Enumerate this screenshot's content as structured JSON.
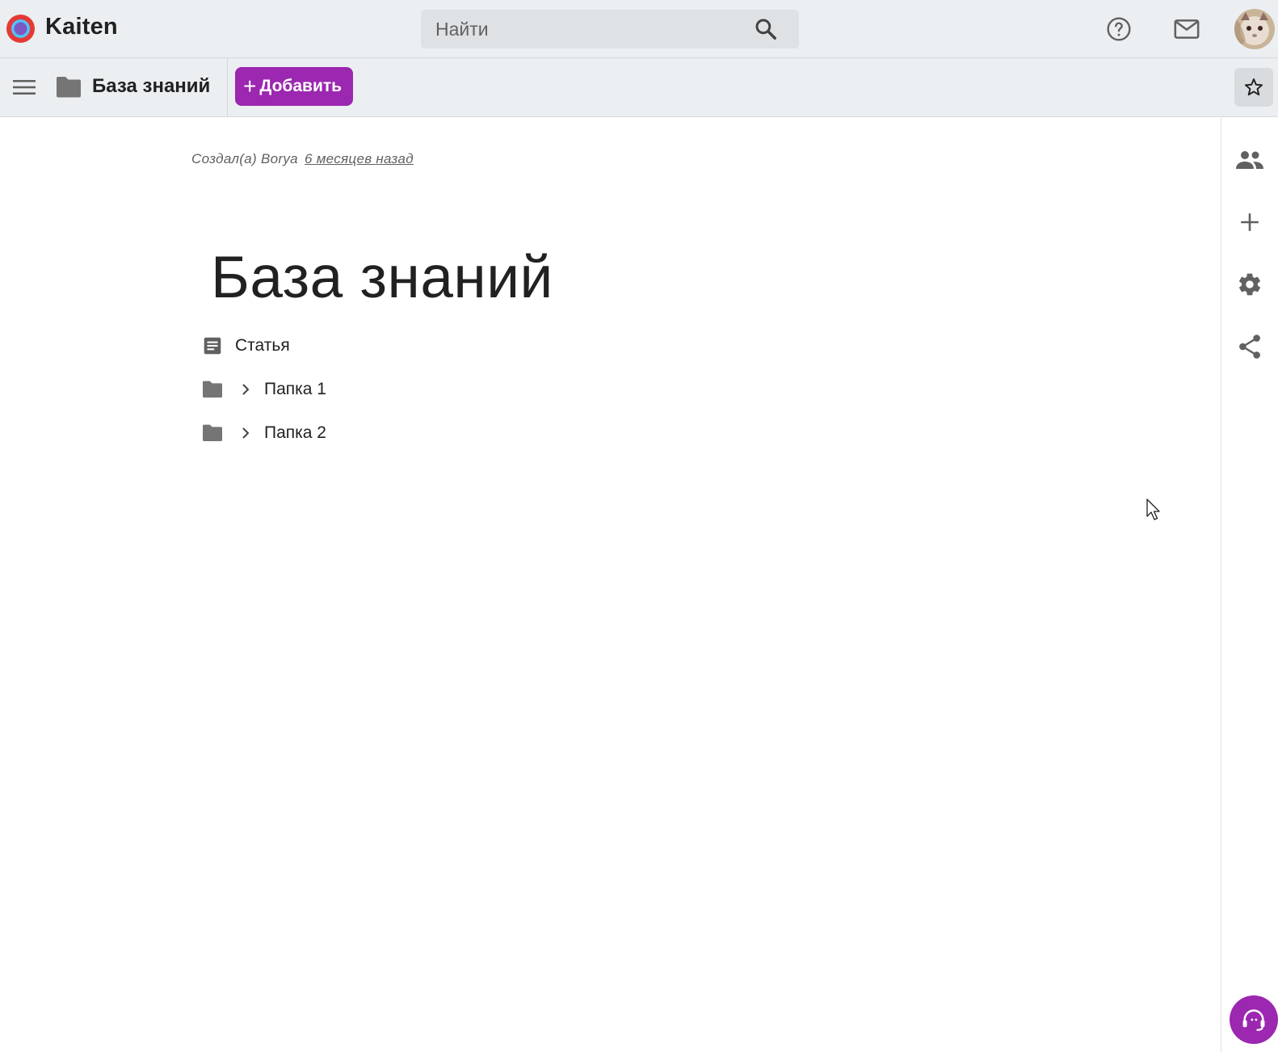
{
  "header": {
    "app_name": "Kaiten",
    "search": {
      "placeholder": "Найти",
      "value": ""
    }
  },
  "subbar": {
    "breadcrumb_title": "База знаний",
    "add_button_label": "Добавить"
  },
  "content": {
    "created_by": "Создал(а) Borya",
    "created_when": "6 месяцев назад",
    "title": "База знаний",
    "items": [
      {
        "type": "article",
        "label": "Статья"
      },
      {
        "type": "folder",
        "label": "Папка 1"
      },
      {
        "type": "folder",
        "label": "Папка 2"
      }
    ]
  },
  "colors": {
    "accent": "#9c27b0",
    "header_bg": "#eceff1",
    "icon_gray": "#757575"
  },
  "icons": [
    "kaiten-logo-icon",
    "search-icon",
    "help-icon",
    "mail-icon",
    "menu-icon",
    "folder-icon",
    "plus-icon",
    "star-icon",
    "people-icon",
    "add-icon",
    "gear-icon",
    "share-icon",
    "article-icon",
    "chevron-right-icon",
    "support-icon"
  ]
}
